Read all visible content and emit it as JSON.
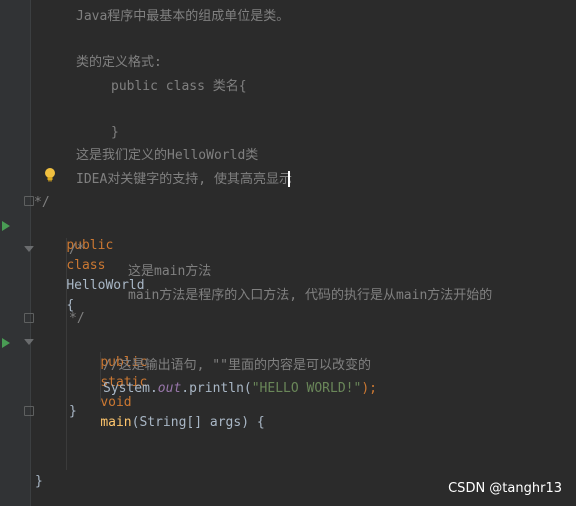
{
  "editor": {
    "lines": {
      "l1": "Java程序中最基本的组成单位是类。",
      "l2": "类的定义格式:",
      "l3": "public class 类名{",
      "l4": "}",
      "l5": "这是我们定义的HelloWorld类",
      "l6": "IDEA对关键字的支持, 使其高亮显示",
      "l7": "*/",
      "l8_kw1": "public",
      "l8_kw2": "class",
      "l8_name": "HelloWorld",
      "l8_brace": "{",
      "l9": "/*",
      "l10": "这是main方法",
      "l11": "main方法是程序的入口方法, 代码的执行是从main方法开始的",
      "l12": "*/",
      "l13_kw1": "public",
      "l13_kw2": "static",
      "l13_kw3": "void",
      "l13_fn": "main",
      "l13_params": "(String[] args) {",
      "l14": "//这是输出语句, \"\"里面的内容是可以改变的",
      "l15_sys": "System.",
      "l15_out": "out",
      "l15_println": ".println(",
      "l15_str": "\"HELLO WORLD!\"",
      "l15_end": ");",
      "l16": "}",
      "l17": "}"
    },
    "icons": {
      "bulb": "lightbulb-icon",
      "run": "run-gutter-icon",
      "fold": "fold-icon"
    }
  },
  "watermark": "CSDN @tanghr13"
}
